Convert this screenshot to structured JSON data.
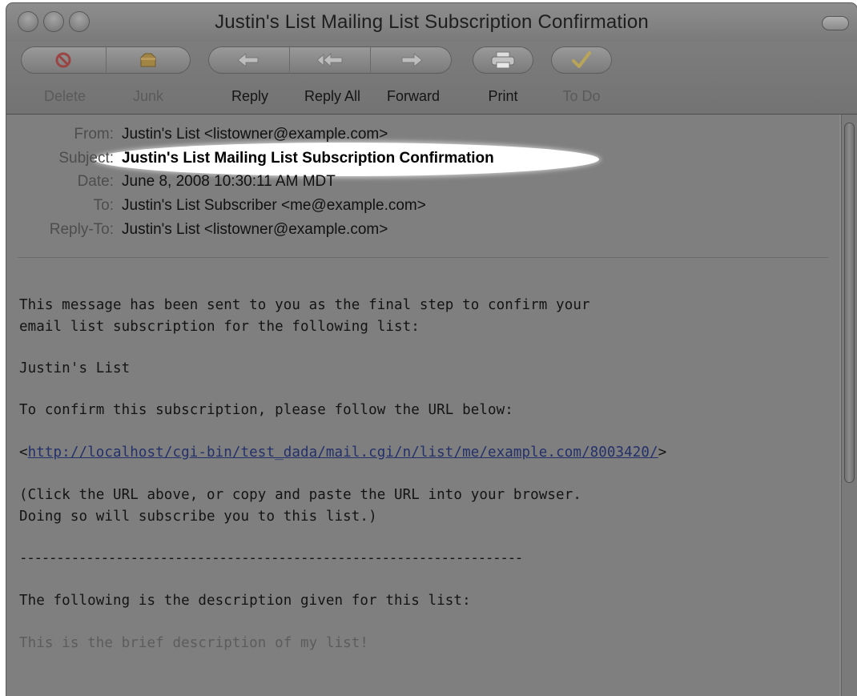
{
  "window": {
    "title": "Justin's List Mailing List Subscription Confirmation"
  },
  "toolbar": {
    "delete_label": "Delete",
    "junk_label": "Junk",
    "reply_label": "Reply",
    "reply_all_label": "Reply All",
    "forward_label": "Forward",
    "print_label": "Print",
    "todo_label": "To Do"
  },
  "headers": {
    "from_key": "From:",
    "from_value": "Justin's List <listowner@example.com>",
    "subject_key": "Subject:",
    "subject_value": "Justin's List Mailing List Subscription Confirmation",
    "date_key": "Date:",
    "date_value": "June 8, 2008 10:30:11 AM MDT",
    "to_key": "To:",
    "to_value": "Justin's List Subscriber <me@example.com>",
    "reply_to_key": "Reply-To:",
    "reply_to_value": "Justin's List <listowner@example.com>"
  },
  "body": {
    "line1": "This message has been sent to you as the final step to confirm your",
    "line2": "email list subscription for the following list:",
    "list_name": "Justin's List",
    "confirm_prompt": "To confirm this subscription, please follow the URL below:",
    "url_prefix": "<",
    "url": "http://localhost/cgi-bin/test_dada/mail.cgi/n/list/me/example.com/8003420/",
    "url_suffix": ">",
    "instructions1": "(Click the URL above, or copy and paste the URL into your browser.",
    "instructions2": "Doing so will subscribe you to this list.)",
    "separator": "--------------------------------------------------------------------",
    "description_intro": "The following is the description given for this list:",
    "description": "This is the brief description of my list!"
  },
  "colors": {
    "window_gray": "#7f7f7f",
    "link": "#23306a",
    "highlight": "#ffffff"
  }
}
